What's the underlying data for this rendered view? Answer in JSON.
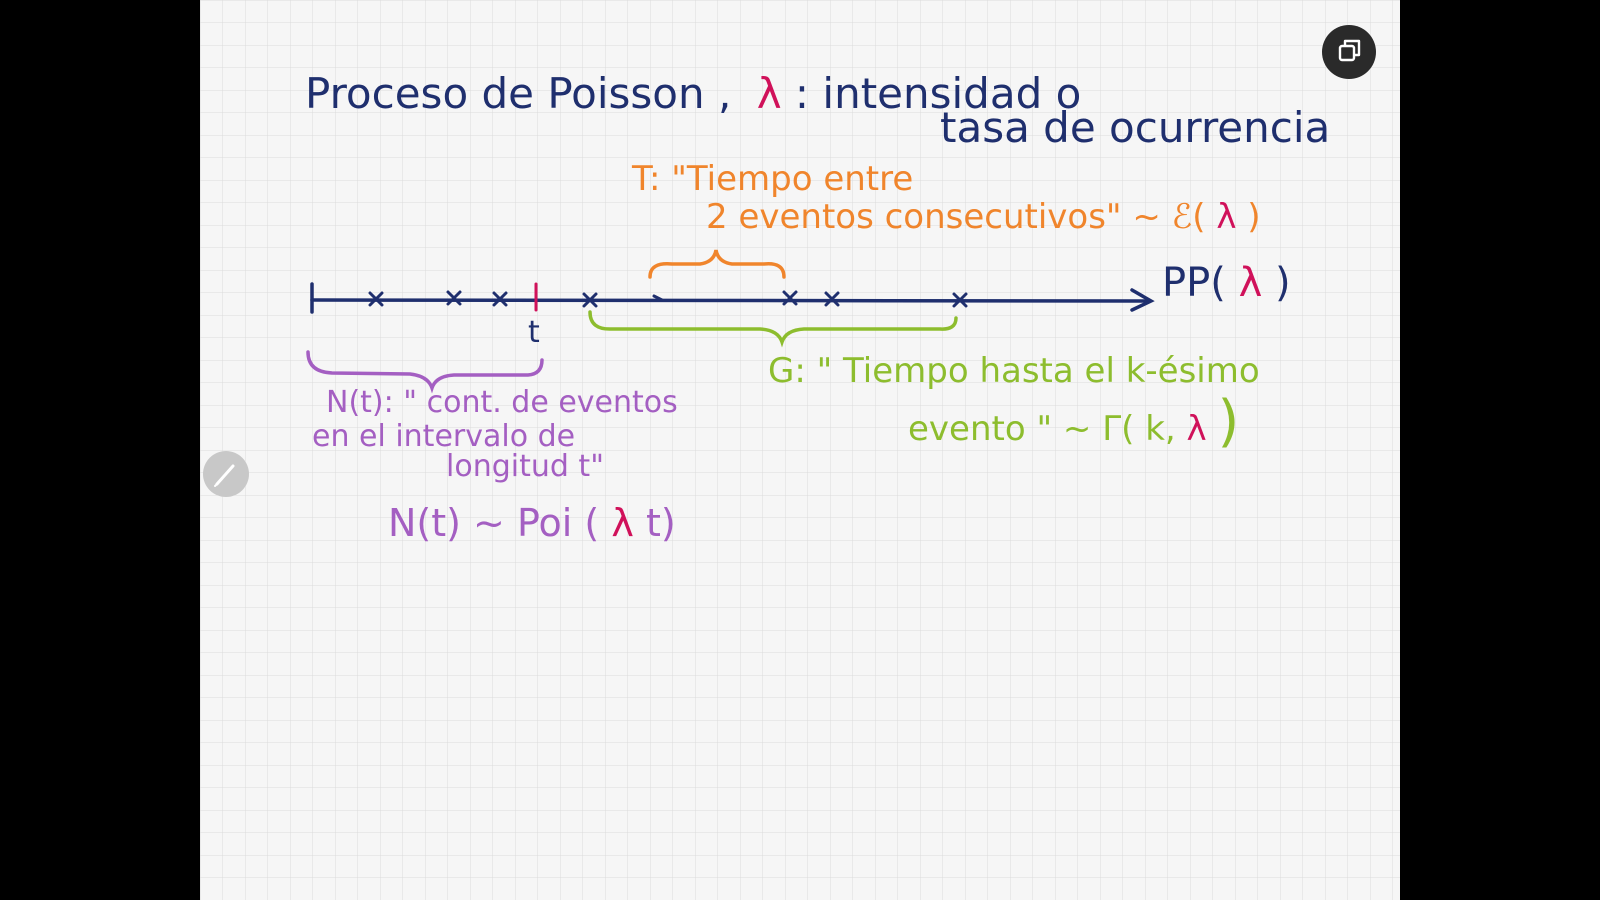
{
  "colors": {
    "background": "#000000",
    "paper": "#f6f6f6",
    "grid": "#dcdcdc",
    "blue": "#1f2f6e",
    "magenta": "#d0115a",
    "orange": "#f0852c",
    "green": "#8dbd2e",
    "purple": "#a45fc2"
  },
  "title": {
    "line1_prefix": "Proceso de Poisson ,",
    "lambda": "λ",
    "line1_suffix": ": intensidad o",
    "line2": "tasa de ocurrencia"
  },
  "orange_note": {
    "line1": "T: \"Tiempo entre",
    "line2_prefix": "2 eventos consecutivos\" ~ ℰ(",
    "lambda": "λ",
    "line2_suffix": ")"
  },
  "axis": {
    "t_label": "t",
    "pp_prefix": "PP(",
    "pp_lambda": "λ",
    "pp_suffix": ")"
  },
  "green_note": {
    "line1": "G: \" Tiempo hasta el k-ésimo",
    "line2_prefix": "evento \" ~ Γ( k,",
    "lambda": "λ",
    "line2_suffix": ")"
  },
  "purple_note": {
    "line1": "N(t): \" cont. de eventos",
    "line2": "en el intervalo de",
    "line3": "longitud t\"",
    "formula_prefix": "N(t) ~ Poi (",
    "formula_lambda": "λ",
    "formula_suffix": "t)"
  },
  "icons": {
    "exit": "exit-fullscreen-icon",
    "pen": "pencil-icon"
  }
}
